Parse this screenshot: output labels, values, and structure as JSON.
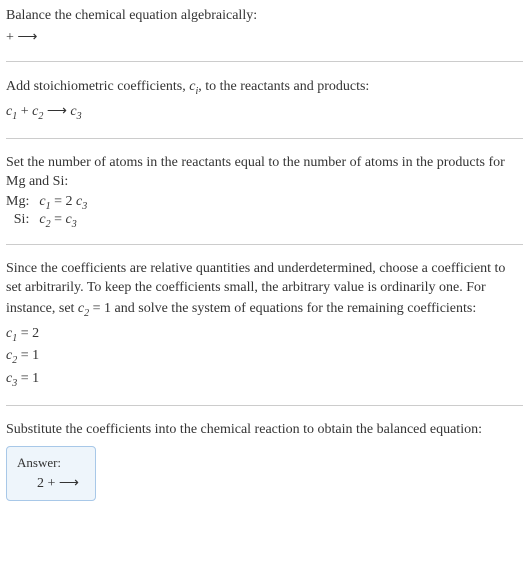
{
  "section1": {
    "line1": "Balance the chemical equation algebraically:",
    "line2_html": " +  ⟶ "
  },
  "section2": {
    "line1_prefix": "Add stoichiometric coefficients, ",
    "line1_ci": "c",
    "line1_ci_sub": "i",
    "line1_suffix": ", to the reactants and products:",
    "eq_c1": "c",
    "eq_c1_sub": "1",
    "eq_plus": "  + ",
    "eq_c2": "c",
    "eq_c2_sub": "2",
    "eq_arrow": "   ⟶  ",
    "eq_c3": "c",
    "eq_c3_sub": "3"
  },
  "section3": {
    "line1": "Set the number of atoms in the reactants equal to the number of atoms in the products for Mg and Si:",
    "rows": [
      {
        "label": "Mg: ",
        "c_left": "c",
        "c_left_sub": "1",
        "mid": " = 2 ",
        "c_right": "c",
        "c_right_sub": "3"
      },
      {
        "label": "Si: ",
        "c_left": "c",
        "c_left_sub": "2",
        "mid": " = ",
        "c_right": "c",
        "c_right_sub": "3"
      }
    ]
  },
  "section4": {
    "line1_a": "Since the coefficients are relative quantities and underdetermined, choose a coefficient to set arbitrarily. To keep the coefficients small, the arbitrary value is ordinarily one. For instance, set ",
    "line1_c": "c",
    "line1_c_sub": "2",
    "line1_b": " = 1 and solve the system of equations for the remaining coefficients:",
    "coefs": [
      {
        "c": "c",
        "sub": "1",
        "val": " = 2"
      },
      {
        "c": "c",
        "sub": "2",
        "val": " = 1"
      },
      {
        "c": "c",
        "sub": "3",
        "val": " = 1"
      }
    ]
  },
  "section5": {
    "line1": "Substitute the coefficients into the chemical reaction to obtain the balanced equation:",
    "answer_label": "Answer:",
    "answer_eq": "2  +  ⟶ "
  }
}
